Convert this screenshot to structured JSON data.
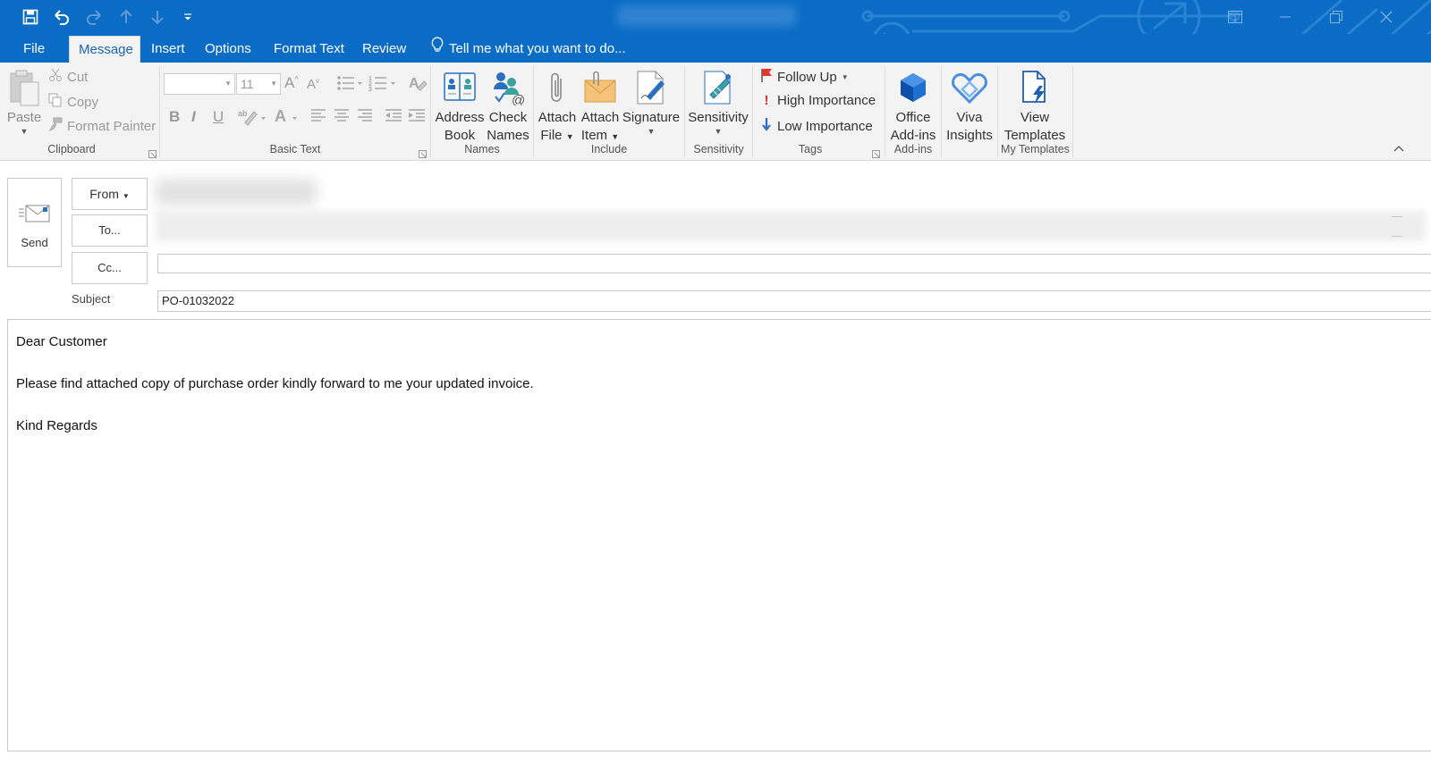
{
  "titlebar": {
    "qat_icons": [
      "save-icon",
      "undo-icon",
      "redo-icon",
      "up-arrow-icon",
      "down-arrow-icon",
      "customize-icon"
    ],
    "window_controls": [
      "ribbon-display-icon",
      "minimize-icon",
      "restore-icon",
      "close-icon"
    ]
  },
  "tabs": {
    "file": "File",
    "message": "Message",
    "insert": "Insert",
    "options": "Options",
    "format_text": "Format Text",
    "review": "Review",
    "tell_me": "Tell me what you want to do..."
  },
  "ribbon": {
    "clipboard": {
      "group": "Clipboard",
      "paste": "Paste",
      "cut": "Cut",
      "copy": "Copy",
      "format_painter": "Format Painter"
    },
    "basic_text": {
      "group": "Basic Text",
      "font_size": "11"
    },
    "names": {
      "group": "Names",
      "address_book": [
        "Address",
        "Book"
      ],
      "check_names": [
        "Check",
        "Names"
      ]
    },
    "include": {
      "group": "Include",
      "attach_file": [
        "Attach",
        "File"
      ],
      "attach_item": [
        "Attach",
        "Item"
      ],
      "signature": "Signature"
    },
    "sensitivity": {
      "group": "Sensitivity",
      "sensitivity": "Sensitivity"
    },
    "tags": {
      "group": "Tags",
      "follow_up": "Follow Up",
      "high_importance": "High Importance",
      "low_importance": "Low Importance"
    },
    "addins": {
      "group": "Add-ins",
      "office_addins": [
        "Office",
        "Add-ins"
      ]
    },
    "viva": {
      "viva_insights": [
        "Viva",
        "Insights"
      ]
    },
    "templates": {
      "group": "My Templates",
      "view_templates": [
        "View",
        "Templates"
      ]
    }
  },
  "compose": {
    "send": "Send",
    "from": "From",
    "to": "To...",
    "cc": "Cc...",
    "subject_label": "Subject",
    "subject": "PO-01032022",
    "cc_value": ""
  },
  "body": {
    "greeting": "Dear Customer",
    "message": "Please find attached copy of purchase order kindly forward to me your updated invoice.",
    "closing": "Kind Regards"
  },
  "colors": {
    "title_blue": "#0a6cc4",
    "ribbon_bg": "#f3f3f3",
    "active_tab_text": "#1d64b5",
    "high_importance": "#d32f2f",
    "low_importance": "#2a6fc0",
    "follow_up_flag": "#e03a2f"
  }
}
